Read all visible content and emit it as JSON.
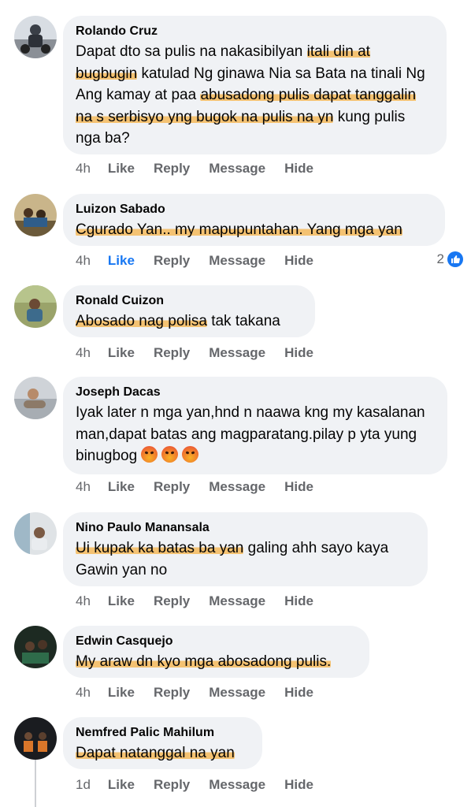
{
  "comments": [
    {
      "author": "Rolando Cruz",
      "segments": [
        {
          "t": "Dapat dto sa pulis na nakasibilyan ",
          "hl": false
        },
        {
          "t": "itali din at bugbugin",
          "hl": true
        },
        {
          "t": " katulad Ng ginawa Nia sa Bata na tinali Ng Ang kamay at paa ",
          "hl": false
        },
        {
          "t": "abusadong pulis dapat tanggalin na s serbisyo yng bugok na pulis na yn",
          "hl": true
        },
        {
          "t": " kung pulis nga ba?",
          "hl": false
        }
      ],
      "time": "4h",
      "like": "Like",
      "reply": "Reply",
      "message": "Message",
      "hide": "Hide"
    },
    {
      "author": "Luizon Sabado",
      "segments": [
        {
          "t": "Cgurado Yan.. my mapupuntahan. Yang mga yan",
          "hl": true
        }
      ],
      "time": "4h",
      "like": "Like",
      "reply": "Reply",
      "message": "Message",
      "hide": "Hide",
      "liked": true,
      "reaction_count": "2",
      "reaction_icon": "like-thumb-icon"
    },
    {
      "author": "Ronald Cuizon",
      "segments": [
        {
          "t": "Abosado nag polisa",
          "hl": true
        },
        {
          "t": " tak takana",
          "hl": false
        }
      ],
      "time": "4h",
      "like": "Like",
      "reply": "Reply",
      "message": "Message",
      "hide": "Hide"
    },
    {
      "author": "Joseph Dacas",
      "segments": [
        {
          "t": "Iyak later n mga yan,hnd n naawa kng my kasalanan man,dapat batas ang magparatang.pilay p yta yung binugbog",
          "hl": false
        }
      ],
      "emoji_count": 3,
      "emoji": "angry-face-emoji",
      "time": "4h",
      "like": "Like",
      "reply": "Reply",
      "message": "Message",
      "hide": "Hide"
    },
    {
      "author": "Nino Paulo Manansala",
      "segments": [
        {
          "t": "Ui kupak ka batas ba yan",
          "hl": true
        },
        {
          "t": " galing ahh sayo kaya Gawin yan no",
          "hl": false
        }
      ],
      "time": "4h",
      "like": "Like",
      "reply": "Reply",
      "message": "Message",
      "hide": "Hide"
    },
    {
      "author": "Edwin Casquejo",
      "segments": [
        {
          "t": "My araw dn kyo mga abosadong pulis.",
          "hl": true
        }
      ],
      "time": "4h",
      "like": "Like",
      "reply": "Reply",
      "message": "Message",
      "hide": "Hide"
    },
    {
      "author": "Nemfred Palic Mahilum",
      "segments": [
        {
          "t": "Dapat natanggal na yan",
          "hl": true
        }
      ],
      "time": "1d",
      "like": "Like",
      "reply": "Reply",
      "message": "Message",
      "hide": "Hide"
    }
  ],
  "colors": {
    "bubble": "#f0f2f5",
    "meta": "#65676b",
    "accent": "#1877f2",
    "highlight": "#f5b246"
  }
}
